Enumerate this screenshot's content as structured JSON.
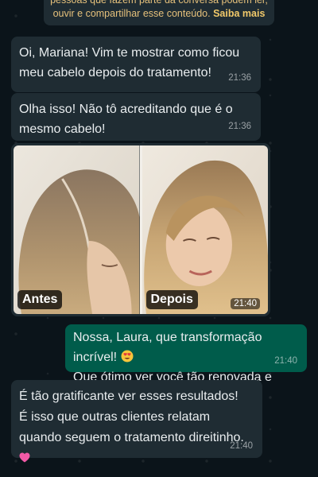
{
  "notice": {
    "text": "pessoas que fazem parte da conversa podem ler, ouvir e compartilhar esse conteúdo.",
    "learn_more": "Saiba mais"
  },
  "messages": [
    {
      "text": "Oi, Mariana! Vim te mostrar como ficou meu cabelo depois do tratamento!",
      "time": "21:36"
    },
    {
      "text": "Olha isso! Não tô acreditando que é o mesmo cabelo!",
      "time": "21:36"
    },
    {
      "before_label": "Antes",
      "after_label": "Depois",
      "time": "21:40"
    },
    {
      "line1": "Nossa, Laura, que transformação incrível!",
      "line2": "Que ótimo ver você tão renovada e feliz!",
      "time": "21:40"
    },
    {
      "line1": "É tão gratificante ver esses resultados!",
      "line2": "É isso que outras clientes relatam",
      "line3": "quando seguem o tratamento direitinho.",
      "time": "21:40"
    }
  ],
  "icons": {
    "emoji_heart_eyes": "smiling-face-with-heart-eyes",
    "emoji_heart": "pink-heart"
  },
  "colors": {
    "background": "#0b141a",
    "incoming": "#1f2c33",
    "outgoing": "#005c4b",
    "notice_text": "#e5c07b"
  }
}
